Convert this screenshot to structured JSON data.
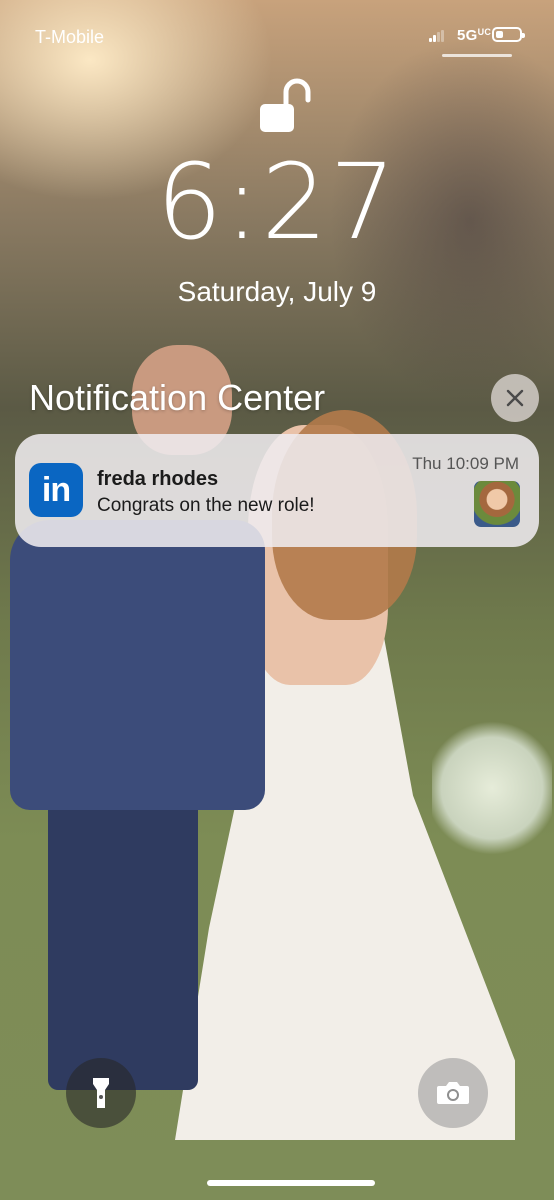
{
  "status_bar": {
    "carrier": "T-Mobile",
    "network": "5G",
    "network_sub": "UC",
    "signal_bars_active": 2,
    "signal_bars_total": 4,
    "battery_level": 0.3,
    "signal_icon": "cellular-signal-icon",
    "battery_icon": "battery-icon"
  },
  "lock": {
    "icon": "unlocked-padlock-icon"
  },
  "clock": {
    "time": "6:27",
    "date": "Saturday, July 9"
  },
  "notification_center": {
    "title": "Notification Center",
    "clear_icon": "close-icon"
  },
  "notification": {
    "app_icon": "linkedin-icon",
    "app_icon_text": "in",
    "app_color": "#0a66c2",
    "sender": "freda rhodes",
    "time": "Thu 10:09 PM",
    "message": "Congrats on the new role!"
  },
  "quick_actions": {
    "flashlight_icon": "flashlight-icon",
    "camera_icon": "camera-icon"
  }
}
